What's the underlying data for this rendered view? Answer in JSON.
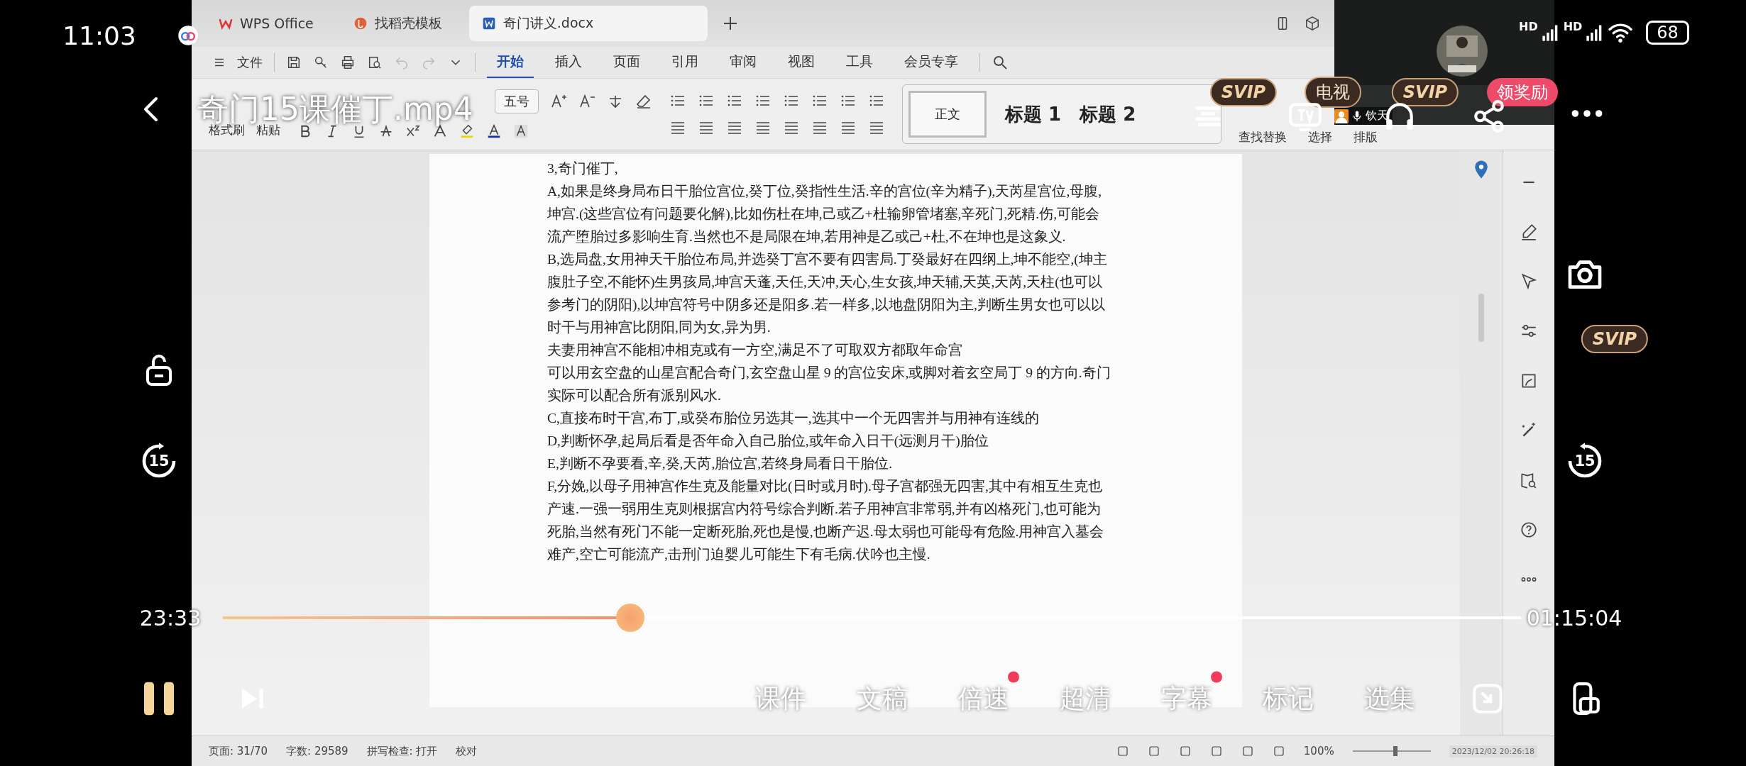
{
  "phone": {
    "time": "11:03",
    "signals": [
      "HD",
      "HD"
    ],
    "battery": "68"
  },
  "player": {
    "title": "奇门15课催丁.mp4",
    "elapsed": "23:33",
    "duration": "01:15:04",
    "progress": {
      "level": 0.314
    },
    "playing": true,
    "top_badges": [
      {
        "label": "SVIP",
        "kind": "svip"
      },
      {
        "label": "电视",
        "kind": "plain"
      },
      {
        "label": "SVIP",
        "kind": "svip"
      },
      {
        "label": "领奖励",
        "kind": "promo"
      }
    ],
    "side_badge": {
      "label": "SVIP",
      "kind": "svip"
    },
    "skip_back": "15",
    "skip_forward": "15",
    "options": [
      {
        "label": "课件",
        "dot": false
      },
      {
        "label": "文稿",
        "dot": false
      },
      {
        "label": "倍速",
        "dot": true
      },
      {
        "label": "超清",
        "dot": false
      },
      {
        "label": "字幕",
        "dot": true
      },
      {
        "label": "标记",
        "dot": false
      },
      {
        "label": "选集",
        "dot": false
      }
    ]
  },
  "wps": {
    "tabs": [
      {
        "label": "WPS Office",
        "kind": "app",
        "selected": false
      },
      {
        "label": "找稻壳模板",
        "kind": "template",
        "selected": false
      },
      {
        "label": "奇门讲义.docx",
        "kind": "doc",
        "selected": true
      }
    ],
    "file_menu": "文件",
    "ribbon_tabs": [
      {
        "label": "开始",
        "selected": true
      },
      {
        "label": "插入",
        "selected": false
      },
      {
        "label": "页面",
        "selected": false
      },
      {
        "label": "引用",
        "selected": false
      },
      {
        "label": "审阅",
        "selected": false
      },
      {
        "label": "视图",
        "selected": false
      },
      {
        "label": "工具",
        "selected": false
      },
      {
        "label": "会员专享",
        "selected": false
      }
    ],
    "format_painter": "格式刷",
    "paste": "粘贴",
    "size": "五号",
    "styles": [
      "正文",
      "标题 1",
      "标题 2"
    ],
    "right_tools": [
      "查找替换",
      "选择",
      "排版"
    ],
    "document": {
      "paragraphs": [
        {
          "lines": [
            "3,奇门催丁,"
          ]
        },
        {
          "lines": [
            "A,如果是终身局布日干胎位宫位,癸丁位,癸指性生活.辛的宫位(辛为精子),天芮星宫位,母腹,",
            "坤宫.(这些宫位有问题要化解),比如伤杜在坤,己或乙+杜输卵管堵塞,辛死门,死精.伤,可能会",
            "流产堕胎过多影响生育.当然也不是局限在坤,若用神是乙或己+杜,不在坤也是这象义."
          ]
        },
        {
          "lines": [
            "B,选局盘,女用神天干胎位布局,并选癸丁宫不要有四害局.丁癸最好在四纲上,坤不能空,(坤主",
            "腹肚子空,不能怀)生男孩局,坤宫天蓬,天任,天冲,天心,生女孩,坤天辅,天英,天芮,天柱(也可以",
            "参考门的阴阳),以坤宫符号中阴多还是阳多.若一样多,以地盘阴阳为主,判断生男女也可以以",
            "时干与用神宫比阴阳,同为女,异为男."
          ]
        },
        {
          "lines": [
            "夫妻用神宫不能相冲相克或有一方空,满足不了可取双方都取年命宫"
          ]
        },
        {
          "lines": [
            "可以用玄空盘的山星宫配合奇门,玄空盘山星 9 的宫位安床,或脚对着玄空局丁 9 的方向.奇门",
            "实际可以配合所有派别风水."
          ]
        },
        {
          "lines": [
            "C,直接布时干宫,布丁,或癸布胎位另选其一,选其中一个无四害并与用神有连线的"
          ]
        },
        {
          "lines": [
            "D,判断怀孕,起局后看是否年命入自己胎位,或年命入日干(远测月干)胎位"
          ]
        },
        {
          "lines": [
            "E,判断不孕要看,辛,癸,天芮,胎位宫,若终身局看日干胎位."
          ]
        },
        {
          "lines": [
            "F,分娩,以母子用神宫作生克及能量对比(日时或月时).母子宫都强无四害,其中有相互生克也",
            "产速.一强一弱用生克则根据宫内符号综合判断.若子用神宫非常弱,并有凶格死门,也可能为",
            "死胎,当然有死门不能一定断死胎,死也是慢,也断产迟.母太弱也可能母有危险.用神宫入墓会",
            "难产,空亡可能流产,击刑门迫婴儿可能生下有毛病.伏吟也主慢."
          ]
        }
      ]
    },
    "status": {
      "page": "页面: 31/70",
      "words": "字数: 29589",
      "spell": "拼写检查: 打开",
      "proofread": "校对",
      "zoom": "100%",
      "zoom_slider": {
        "level": 0.55
      },
      "clock": "2023/12/02 20:26:18"
    },
    "webcam": {
      "kind": "picture",
      "caption": "钦天"
    }
  }
}
